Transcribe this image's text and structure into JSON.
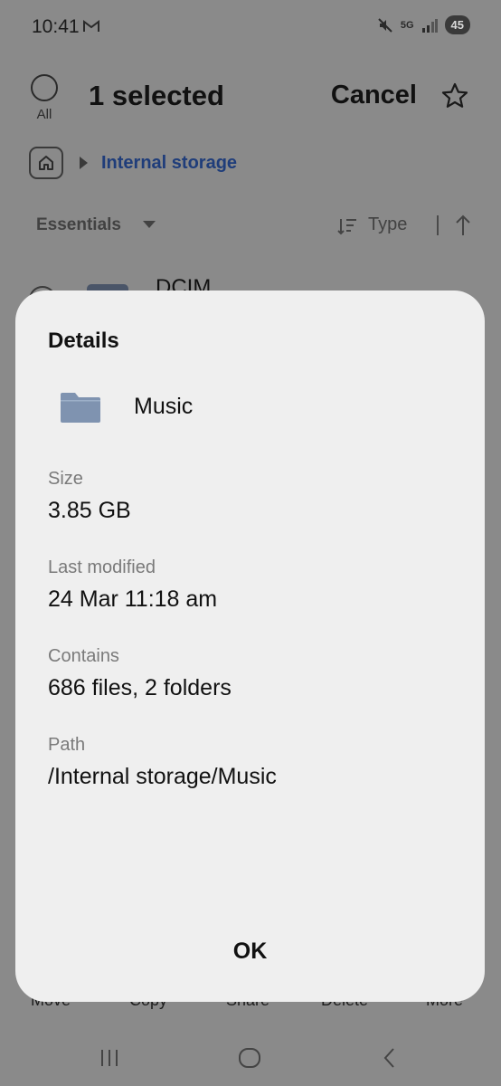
{
  "status_bar": {
    "time": "10:41",
    "network": "5G",
    "battery": "45"
  },
  "header": {
    "select_all_label": "All",
    "title": "1 selected",
    "cancel_label": "Cancel"
  },
  "breadcrumb": {
    "current": "Internal storage"
  },
  "sort_bar": {
    "filter_label": "Essentials",
    "sort_label": "Type"
  },
  "list": {
    "items": [
      {
        "name": "DCIM"
      }
    ]
  },
  "bottom_actions": [
    "Move",
    "Copy",
    "Share",
    "Delete",
    "More"
  ],
  "dialog": {
    "title": "Details",
    "item_name": "Music",
    "fields": [
      {
        "label": "Size",
        "value": "3.85 GB"
      },
      {
        "label": "Last modified",
        "value": "24 Mar 11:18 am"
      },
      {
        "label": "Contains",
        "value": "686 files, 2 folders"
      },
      {
        "label": "Path",
        "value": "/Internal storage/Music"
      }
    ],
    "ok_label": "OK"
  },
  "colors": {
    "accent": "#2b4fa8",
    "folder": "#7f93b0",
    "dialog_bg": "#efefef"
  },
  "icons": {
    "status": [
      "gmail-icon",
      "mute-icon",
      "signal-icon",
      "battery-icon"
    ],
    "header": [
      "star-icon"
    ],
    "nav": [
      "recent-apps-icon",
      "home-icon",
      "back-icon"
    ]
  }
}
